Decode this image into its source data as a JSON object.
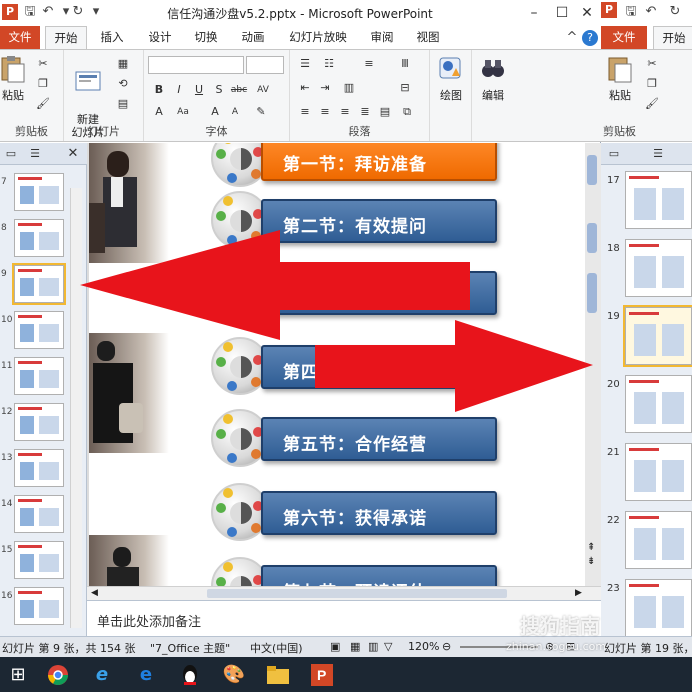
{
  "window": {
    "title": "信任沟通沙盘v5.2.pptx - Microsoft PowerPoint",
    "minimize": "–",
    "maximize": "☐",
    "close": "✕"
  },
  "tabs": [
    "文件",
    "开始",
    "插入",
    "设计",
    "切换",
    "动画",
    "幻灯片放映",
    "审阅",
    "视图"
  ],
  "ribbon": {
    "clipboard": {
      "paste": "粘贴",
      "label": "剪贴板"
    },
    "slides": {
      "new_slide": "新建\n幻灯片",
      "label": "幻灯片"
    },
    "font": {
      "label": "字体"
    },
    "paragraph": {
      "label": "段落"
    },
    "drawing": {
      "label": "绘图"
    },
    "editing": {
      "label": "编辑"
    }
  },
  "slide_panel": {
    "thumbnails": [
      {
        "num": "7"
      },
      {
        "num": "8"
      },
      {
        "num": "9",
        "selected": true
      },
      {
        "num": "10"
      },
      {
        "num": "11"
      },
      {
        "num": "12"
      },
      {
        "num": "13"
      },
      {
        "num": "14"
      },
      {
        "num": "15"
      },
      {
        "num": "16"
      }
    ]
  },
  "slide": {
    "items": [
      {
        "text": "第一节：拜访准备",
        "style": "orange"
      },
      {
        "text": "第二节：有效提问",
        "style": "blue"
      },
      {
        "text": "",
        "style": "blue"
      },
      {
        "text": "第四",
        "style": "blue"
      },
      {
        "text": "第五节：合作经营",
        "style": "blue"
      },
      {
        "text": "第六节：获得承诺",
        "style": "blue"
      },
      {
        "text": "第七节：预读评估",
        "style": "blue"
      }
    ]
  },
  "notes": {
    "placeholder": "单击此处添加备注"
  },
  "status": {
    "slide_info": "幻灯片 第 9 张，共 154 张",
    "theme": "\"7_Office 主题\"",
    "language": "中文(中国)",
    "zoom": "120%",
    "right_slide_info": "幻灯片 第 19 张，"
  },
  "right_window": {
    "tabs": [
      "文件",
      "开始"
    ],
    "paste": "粘贴",
    "clipboard_label": "剪贴板",
    "thumbnails": [
      {
        "num": "17"
      },
      {
        "num": "18"
      },
      {
        "num": "19",
        "selected": true
      },
      {
        "num": "20"
      },
      {
        "num": "21"
      },
      {
        "num": "22"
      },
      {
        "num": "23"
      }
    ]
  },
  "watermark": {
    "brand": "搜狗指南",
    "url": "zhinan.sogou.com"
  },
  "taskbar": {
    "items": [
      "windows-start",
      "chrome",
      "ie-edge",
      "edge",
      "qq",
      "paint",
      "file-explorer",
      "powerpoint"
    ]
  },
  "colors": {
    "file_tab": "#d24726",
    "banner_blue": "#2f5d94",
    "banner_orange": "#ef6a00",
    "arrow_red": "#e8141b"
  }
}
